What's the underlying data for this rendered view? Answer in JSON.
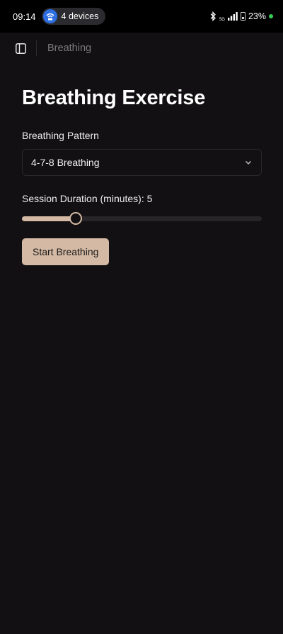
{
  "status_bar": {
    "time": "09:14",
    "devices": "4 devices",
    "network": "5G",
    "battery": "23%",
    "icons": [
      "wifi-hotspot-icon",
      "bluetooth-icon",
      "signal-icon",
      "battery-icon"
    ]
  },
  "topbar": {
    "breadcrumb": "Breathing",
    "icon": "sidebar-toggle-icon"
  },
  "main": {
    "title": "Breathing Exercise",
    "pattern_label": "Breathing Pattern",
    "pattern_value": "4-7-8 Breathing",
    "duration_label": "Session Duration (minutes): 5",
    "duration_fraction": 0.225,
    "start_button": "Start Breathing"
  },
  "colors": {
    "accent": "#d4b9a4",
    "background": "#121012",
    "charging": "#33cc55"
  }
}
